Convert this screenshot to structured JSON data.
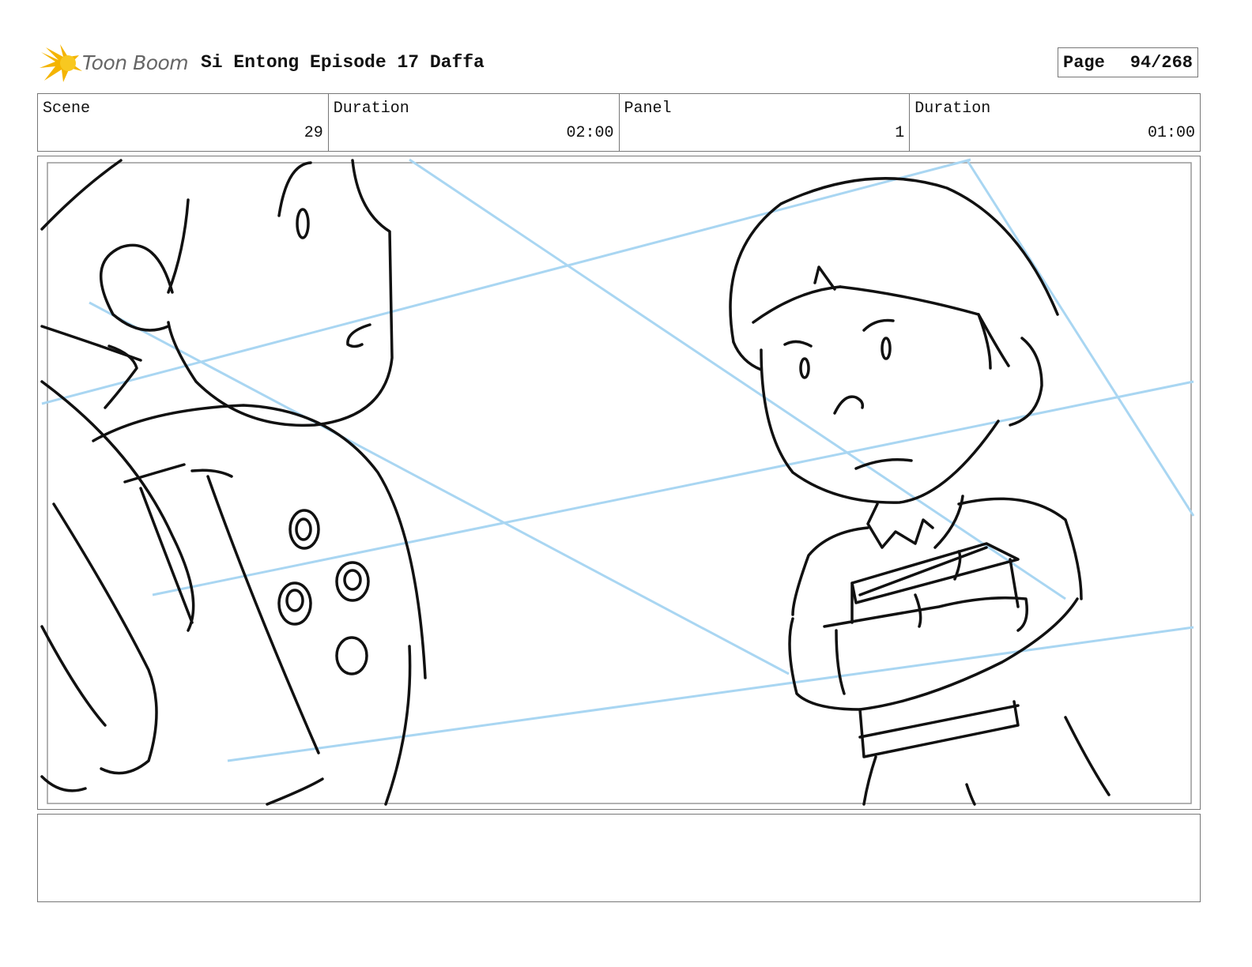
{
  "header": {
    "logo_text": "Toon Boom",
    "title": "Si Entong Episode 17 Daffa",
    "page_label": "Page",
    "page_value": "94/268"
  },
  "info": {
    "scene_label": "Scene",
    "scene_value": "29",
    "scene_duration_label": "Duration",
    "scene_duration_value": "02:00",
    "panel_label": "Panel",
    "panel_value": "1",
    "panel_duration_label": "Duration",
    "panel_duration_value": "01:00"
  },
  "notes": {
    "text": ""
  },
  "colors": {
    "guide_lines": "#a9d6f2",
    "ink": "#111111",
    "frame": "#777777",
    "logo_star": "#f4b400"
  }
}
